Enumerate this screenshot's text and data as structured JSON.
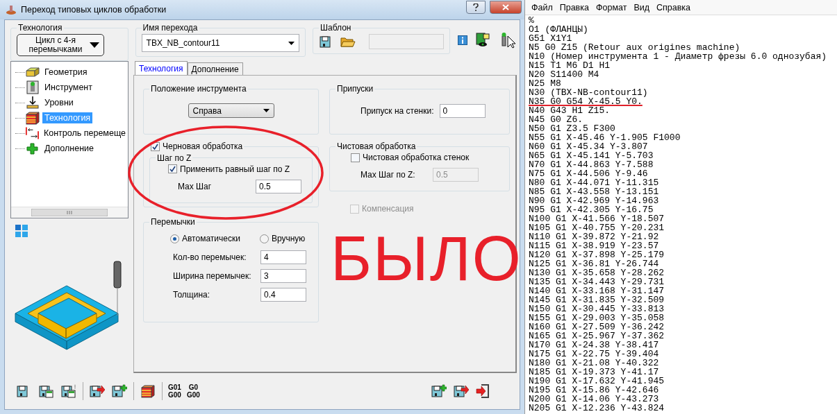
{
  "window": {
    "title": "Переход типовых циклов обработки"
  },
  "technology": {
    "label": "Технология",
    "value": "Цикл с 4-я перемычками"
  },
  "operation_name": {
    "label": "Имя перехода",
    "value": "TBX_NB_contour11"
  },
  "template": {
    "label": "Шаблон"
  },
  "tree": {
    "items": [
      {
        "kind": "geometry",
        "label": "Геометрия",
        "selected": false
      },
      {
        "kind": "tool",
        "label": "Инструмент",
        "selected": false
      },
      {
        "kind": "levels",
        "label": "Уровни",
        "selected": false
      },
      {
        "kind": "technology",
        "label": "Технология",
        "selected": true
      },
      {
        "kind": "control",
        "label": "Контроль перемеще",
        "selected": false
      },
      {
        "kind": "extra",
        "label": "Дополнение",
        "selected": false
      }
    ]
  },
  "tabs": [
    {
      "label": "Технология",
      "selected": true
    },
    {
      "label": "Дополнение",
      "selected": false
    }
  ],
  "tool_position": {
    "label": "Положение инструмента",
    "value": "Справа"
  },
  "allowances": {
    "label": "Припуски",
    "field_label": "Припуск на стенки:",
    "value": "0"
  },
  "roughing": {
    "label": "Черновая обработка",
    "checked": true,
    "z_step": {
      "label": "Шаг по Z",
      "equal_step": {
        "label": "Применить равный шаг по Z",
        "checked": true
      },
      "max_step": {
        "label": "Max Шаг",
        "value": "0.5"
      }
    }
  },
  "finishing": {
    "label": "Чистовая обработка",
    "walls": {
      "label": "Чистовая обработка стенок",
      "checked": false
    },
    "max_step": {
      "label": "Max Шаг по Z:",
      "value": "0.5",
      "disabled": true
    }
  },
  "compensation": {
    "label": "Компенсация",
    "checked": false,
    "disabled": true
  },
  "bridges": {
    "label": "Перемычки",
    "modes": [
      {
        "label": "Автоматически",
        "selected": true
      },
      {
        "label": "Вручную",
        "selected": false
      }
    ],
    "fields": [
      {
        "label": "Кол-во перемычек:",
        "value": "4"
      },
      {
        "label": "Ширина перемычек:",
        "value": "3"
      },
      {
        "label": "Толщина:",
        "value": "0.4"
      }
    ]
  },
  "gcode_buttons": [
    {
      "top": "G01",
      "bottom": "G00"
    },
    {
      "top": "G0",
      "bottom": "G00"
    }
  ],
  "annotation": {
    "text": "БЫЛО"
  },
  "notepad": {
    "menu": [
      "Файл",
      "Правка",
      "Формат",
      "Вид",
      "Справка"
    ],
    "lines": [
      {
        "text": "%",
        "underlined": false
      },
      {
        "text": "O1 (ФЛАНЦЫ)",
        "underlined": false
      },
      {
        "text": "G51 X1Y1",
        "underlined": false
      },
      {
        "text": "N5 G0 Z15 (Retour aux origines machine)",
        "underlined": false
      },
      {
        "text": "N10 (Номер инструмента 1 - Диаметр фрезы 6.0 однозубая)",
        "underlined": false
      },
      {
        "text": "N15 T1 M6 D1 H1",
        "underlined": false
      },
      {
        "text": "N20 S11400 M4",
        "underlined": false
      },
      {
        "text": "N25 M8",
        "underlined": false
      },
      {
        "text": "N30 (TBX-NB-contour11)",
        "underlined": false
      },
      {
        "text": "N35 G0 G54 X-45.5 Y0.",
        "underlined": true
      },
      {
        "text": "N40 G43 H1 Z15.",
        "underlined": false
      },
      {
        "text": "N45 G0 Z6.",
        "underlined": false
      },
      {
        "text": "N50 G1 Z3.5 F300",
        "underlined": false
      },
      {
        "text": "N55 G1 X-45.46 Y-1.905 F1000",
        "underlined": false
      },
      {
        "text": "N60 G1 X-45.34 Y-3.807",
        "underlined": false
      },
      {
        "text": "N65 G1 X-45.141 Y-5.703",
        "underlined": false
      },
      {
        "text": "N70 G1 X-44.863 Y-7.588",
        "underlined": false
      },
      {
        "text": "N75 G1 X-44.506 Y-9.46",
        "underlined": false
      },
      {
        "text": "N80 G1 X-44.071 Y-11.315",
        "underlined": false
      },
      {
        "text": "N85 G1 X-43.558 Y-13.151",
        "underlined": false
      },
      {
        "text": "N90 G1 X-42.969 Y-14.963",
        "underlined": false
      },
      {
        "text": "N95 G1 X-42.305 Y-16.75",
        "underlined": false
      },
      {
        "text": "N100 G1 X-41.566 Y-18.507",
        "underlined": false
      },
      {
        "text": "N105 G1 X-40.755 Y-20.231",
        "underlined": false
      },
      {
        "text": "N110 G1 X-39.872 Y-21.92",
        "underlined": false
      },
      {
        "text": "N115 G1 X-38.919 Y-23.57",
        "underlined": false
      },
      {
        "text": "N120 G1 X-37.898 Y-25.179",
        "underlined": false
      },
      {
        "text": "N125 G1 X-36.81 Y-26.744",
        "underlined": false
      },
      {
        "text": "N130 G1 X-35.658 Y-28.262",
        "underlined": false
      },
      {
        "text": "N135 G1 X-34.443 Y-29.731",
        "underlined": false
      },
      {
        "text": "N140 G1 X-33.168 Y-31.147",
        "underlined": false
      },
      {
        "text": "N145 G1 X-31.835 Y-32.509",
        "underlined": false
      },
      {
        "text": "N150 G1 X-30.445 Y-33.813",
        "underlined": false
      },
      {
        "text": "N155 G1 X-29.003 Y-35.058",
        "underlined": false
      },
      {
        "text": "N160 G1 X-27.509 Y-36.242",
        "underlined": false
      },
      {
        "text": "N165 G1 X-25.967 Y-37.362",
        "underlined": false
      },
      {
        "text": "N170 G1 X-24.38 Y-38.417",
        "underlined": false
      },
      {
        "text": "N175 G1 X-22.75 Y-39.404",
        "underlined": false
      },
      {
        "text": "N180 G1 X-21.08 Y-40.322",
        "underlined": false
      },
      {
        "text": "N185 G1 X-19.373 Y-41.17",
        "underlined": false
      },
      {
        "text": "N190 G1 X-17.632 Y-41.945",
        "underlined": false
      },
      {
        "text": "N195 G1 X-15.86 Y-42.646",
        "underlined": false
      },
      {
        "text": "N200 G1 X-14.06 Y-43.273",
        "underlined": false
      },
      {
        "text": "N205 G1 X-12.236 Y-43.824",
        "underlined": false
      }
    ]
  }
}
